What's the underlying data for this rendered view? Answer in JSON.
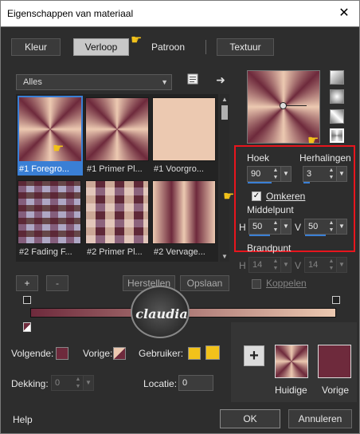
{
  "window": {
    "title": "Eigenschappen van materiaal",
    "close_glyph": "✕"
  },
  "tabs": [
    {
      "label": "Kleur",
      "active": false
    },
    {
      "label": "Verloop",
      "active": true
    },
    {
      "label": "Patroon",
      "active": false
    },
    {
      "label": "Textuur",
      "active": false
    }
  ],
  "library": {
    "category": "Alles",
    "items": [
      {
        "label": "#1 Foregro...",
        "selected": true
      },
      {
        "label": "#1 Primer Pl...",
        "selected": false
      },
      {
        "label": "#1 Voorgro...",
        "selected": false
      },
      {
        "label": "#2 Fading F...",
        "selected": false
      },
      {
        "label": "#2 Primer Pl...",
        "selected": false
      },
      {
        "label": "#2 Vervage...",
        "selected": false
      }
    ]
  },
  "settings": {
    "hoek_label": "Hoek",
    "hoek_value": "90",
    "herhalingen_label": "Herhalingen",
    "herhalingen_value": "3",
    "omkeren_label": "Omkeren",
    "omkeren_checked": true,
    "middelpunt_label": "Middelpunt",
    "h_label": "H",
    "h_value": "50",
    "v_label": "V",
    "v_value": "50",
    "brandpunt_label": "Brandpunt",
    "bh_value": "14",
    "bv_value": "14",
    "koppelen_label": "Koppelen"
  },
  "editor": {
    "add_label": "+",
    "remove_label": "-",
    "reset_label": "Herstellen",
    "save_label": "Opslaan",
    "watermark_text": "claudia"
  },
  "colors": {
    "dark": "#6e2a3c",
    "light": "#ecc9b1",
    "user_swatch": "#f2c21a",
    "accent": "#3a7fd5",
    "highlight_border": "#e8151d"
  },
  "bottom": {
    "volgende_label": "Volgende:",
    "vorige_label": "Vorige:",
    "gebruiker_label": "Gebruiker:",
    "dekking_label": "Dekking:",
    "dekking_value": "0",
    "locatie_label": "Locatie:",
    "locatie_value": "0",
    "huidige_label": "Huidige",
    "vorige_swatch_label": "Vorige"
  },
  "footer": {
    "help_label": "Help",
    "ok_label": "OK",
    "cancel_label": "Annuleren"
  }
}
